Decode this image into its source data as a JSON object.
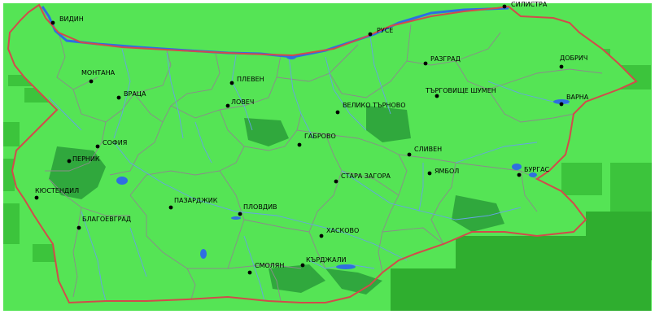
{
  "map": {
    "colors": {
      "land": "#55e455",
      "land_dark": "#33b033",
      "forest": "#2a9d3a",
      "border": "#d24b4b",
      "admin": "#8b8b8b",
      "river": "#66a3e6",
      "river_big": "#2b6fe3",
      "lake": "#2f6fe0",
      "city_dot": "#000000"
    },
    "cities": [
      {
        "id": "vidin",
        "name": "ВИДИН"
      },
      {
        "id": "silistra",
        "name": "СИЛИСТРА"
      },
      {
        "id": "ruse",
        "name": "РУСЕ"
      },
      {
        "id": "razgrad",
        "name": "РАЗГРАД"
      },
      {
        "id": "dobrich",
        "name": "ДОБРИЧ"
      },
      {
        "id": "montana",
        "name": "МОНТАНА"
      },
      {
        "id": "pleven",
        "name": "ПЛЕВЕН"
      },
      {
        "id": "vratsa",
        "name": "ВРАЦА"
      },
      {
        "id": "lovech",
        "name": "ЛОВЕЧ"
      },
      {
        "id": "veliko_tarnovo",
        "name": "ВЕЛИКО ТЪРНОВО"
      },
      {
        "id": "targovishte_shumen",
        "name": "ТЪРГОВИЩЕ ШУМЕН"
      },
      {
        "id": "varna",
        "name": "ВАРНА"
      },
      {
        "id": "sofia",
        "name": "СОФИЯ"
      },
      {
        "id": "gabrovo",
        "name": "ГАБРОВО"
      },
      {
        "id": "sliven",
        "name": "СЛИВЕН"
      },
      {
        "id": "pernik",
        "name": "ПЕРНИК"
      },
      {
        "id": "kyustendil",
        "name": "КЮСТЕНДИЛ"
      },
      {
        "id": "stara_zagora",
        "name": "СТАРА ЗАГОРА"
      },
      {
        "id": "yambol",
        "name": "ЯМБОЛ"
      },
      {
        "id": "burgas",
        "name": "БУРГАС"
      },
      {
        "id": "pazardzhik",
        "name": "ПАЗАРДЖИК"
      },
      {
        "id": "plovdiv",
        "name": "ПЛОВДИВ"
      },
      {
        "id": "blagoevgrad",
        "name": "БЛАГОЕВГРАД"
      },
      {
        "id": "haskovo",
        "name": "ХАСКОВО"
      },
      {
        "id": "kardzhali",
        "name": "КЪРДЖАЛИ"
      },
      {
        "id": "smolyan",
        "name": "СМОЛЯН"
      }
    ]
  }
}
